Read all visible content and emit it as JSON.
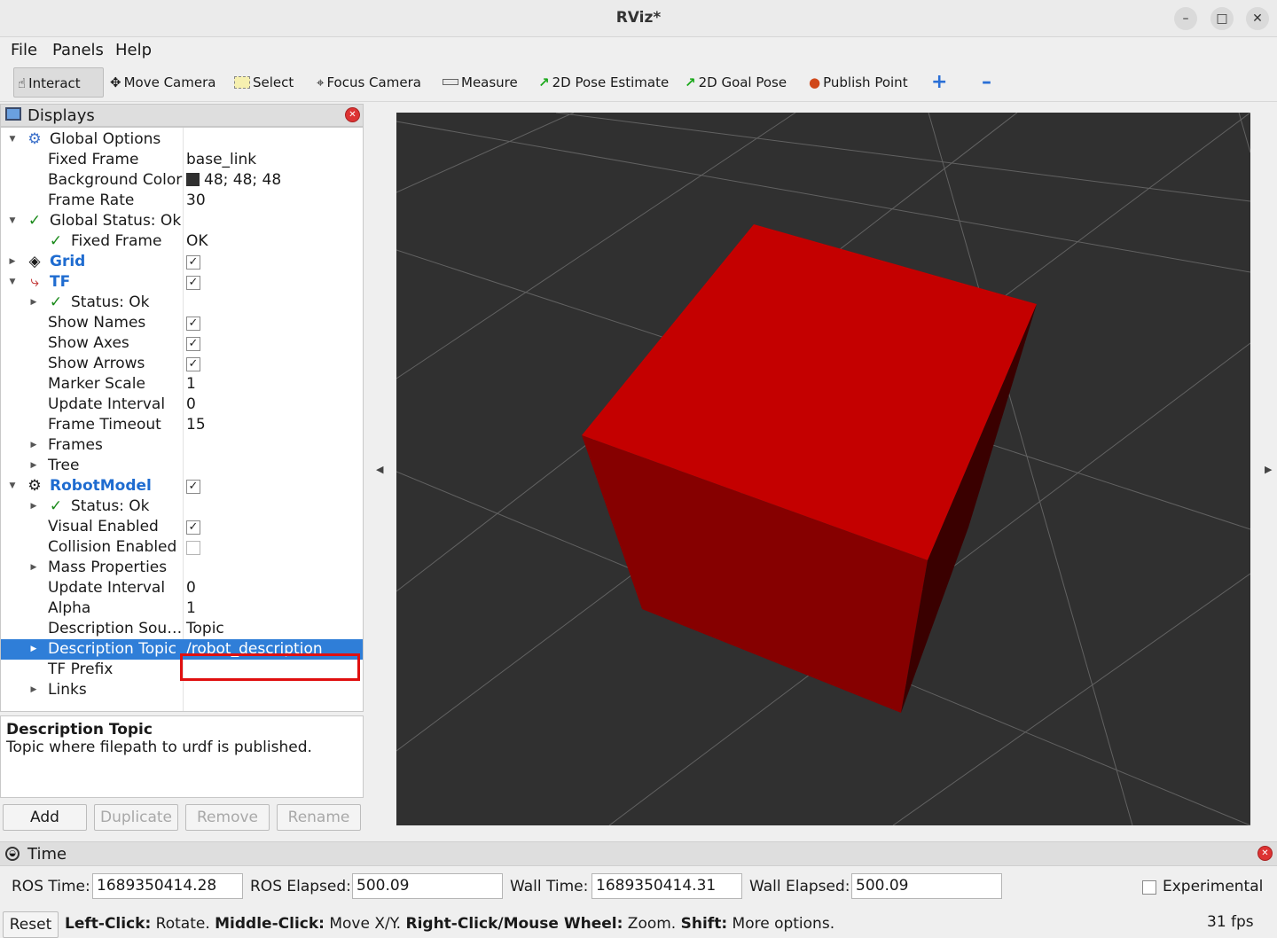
{
  "window": {
    "title": "RViz*"
  },
  "menu": [
    "File",
    "Panels",
    "Help"
  ],
  "toolbar": {
    "interact": "Interact",
    "move_camera": "Move Camera",
    "select": "Select",
    "focus_camera": "Focus Camera",
    "measure": "Measure",
    "pose_estimate": "2D Pose Estimate",
    "goal_pose": "2D Goal Pose",
    "publish_point": "Publish Point"
  },
  "displays": {
    "title": "Displays",
    "rows": [
      {
        "name": "Global Options",
        "value": ""
      },
      {
        "name": "Fixed Frame",
        "value": "base_link"
      },
      {
        "name": "Background Color",
        "value": "48; 48; 48"
      },
      {
        "name": "Frame Rate",
        "value": "30"
      },
      {
        "name": "Global Status: Ok",
        "value": ""
      },
      {
        "name": "Fixed Frame",
        "value": "OK"
      },
      {
        "name": "Grid",
        "value": ""
      },
      {
        "name": "TF",
        "value": ""
      },
      {
        "name": "Status: Ok",
        "value": ""
      },
      {
        "name": "Show Names",
        "value": ""
      },
      {
        "name": "Show Axes",
        "value": ""
      },
      {
        "name": "Show Arrows",
        "value": ""
      },
      {
        "name": "Marker Scale",
        "value": "1"
      },
      {
        "name": "Update Interval",
        "value": "0"
      },
      {
        "name": "Frame Timeout",
        "value": "15"
      },
      {
        "name": "Frames",
        "value": ""
      },
      {
        "name": "Tree",
        "value": ""
      },
      {
        "name": "RobotModel",
        "value": ""
      },
      {
        "name": "Status: Ok",
        "value": ""
      },
      {
        "name": "Visual Enabled",
        "value": ""
      },
      {
        "name": "Collision Enabled",
        "value": ""
      },
      {
        "name": "Mass Properties",
        "value": ""
      },
      {
        "name": "Update Interval",
        "value": "0"
      },
      {
        "name": "Alpha",
        "value": "1"
      },
      {
        "name": "Description Sou…",
        "value": "Topic"
      },
      {
        "name": "Description Topic",
        "value": "/robot_description"
      },
      {
        "name": "TF Prefix",
        "value": ""
      },
      {
        "name": "Links",
        "value": ""
      }
    ]
  },
  "description": {
    "heading": "Description Topic",
    "text": "Topic where filepath to urdf is published."
  },
  "buttons": {
    "add": "Add",
    "duplicate": "Duplicate",
    "remove": "Remove",
    "rename": "Rename"
  },
  "time": {
    "title": "Time",
    "ros_time_label": "ROS Time:",
    "ros_time": "1689350414.28",
    "ros_elapsed_label": "ROS Elapsed:",
    "ros_elapsed": "500.09",
    "wall_time_label": "Wall Time:",
    "wall_time": "1689350414.31",
    "wall_elapsed_label": "Wall Elapsed:",
    "wall_elapsed": "500.09",
    "experimental": "Experimental",
    "reset": "Reset",
    "fps": "31 fps"
  },
  "status_bar": {
    "left_click": "Left-Click:",
    "left_click_text": " Rotate. ",
    "middle_click": "Middle-Click:",
    "middle_click_text": " Move X/Y. ",
    "right_click": "Right-Click/Mouse Wheel:",
    "right_click_text": " Zoom. ",
    "shift": "Shift:",
    "shift_text": " More options."
  },
  "colors": {
    "background": "#303030",
    "cube": "#c40000",
    "selection": "#2f7ed8",
    "highlight_box": "#e01010"
  }
}
